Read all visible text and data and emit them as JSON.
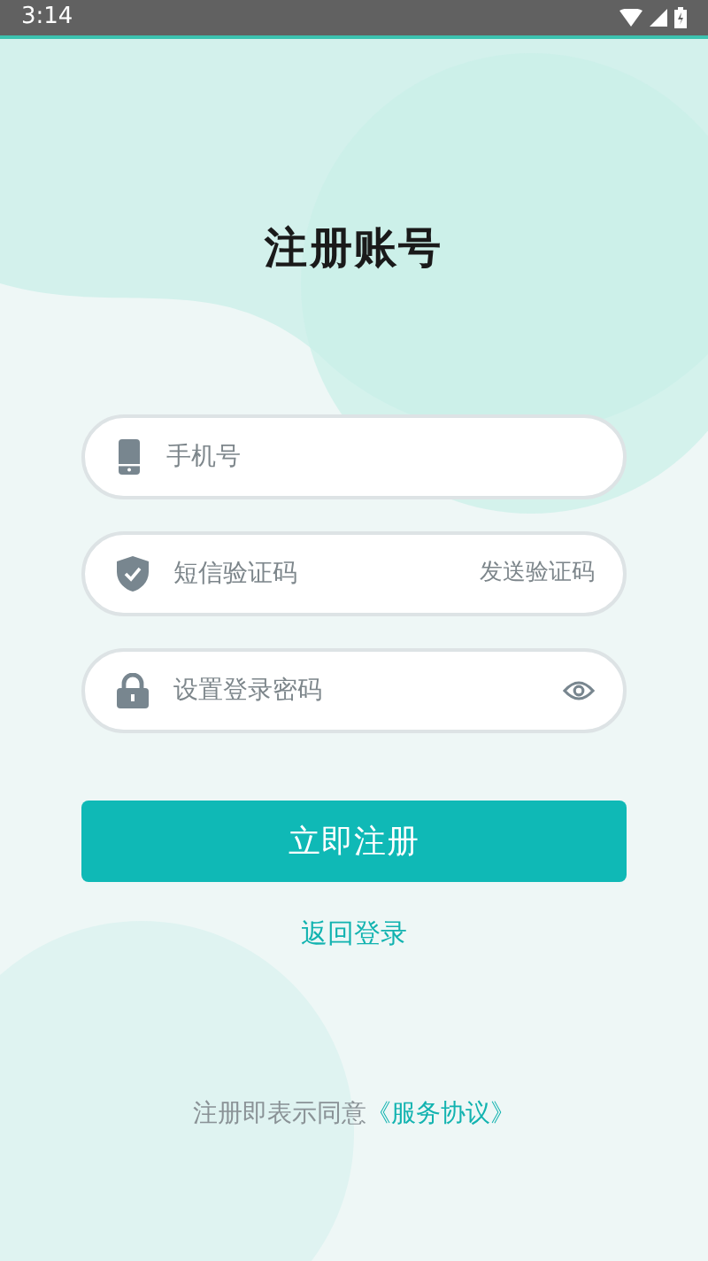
{
  "status_bar": {
    "time": "3:14"
  },
  "title": "注册账号",
  "fields": [
    {
      "kind": "phone",
      "placeholder": "手机号"
    },
    {
      "kind": "code",
      "placeholder": "短信验证码",
      "action": "发送验证码"
    },
    {
      "kind": "password",
      "placeholder": "设置登录密码"
    }
  ],
  "submit_button": "立即注册",
  "back_link": "返回登录",
  "agreement": {
    "text": "注册即表示同意",
    "link": "《服务协议》"
  }
}
